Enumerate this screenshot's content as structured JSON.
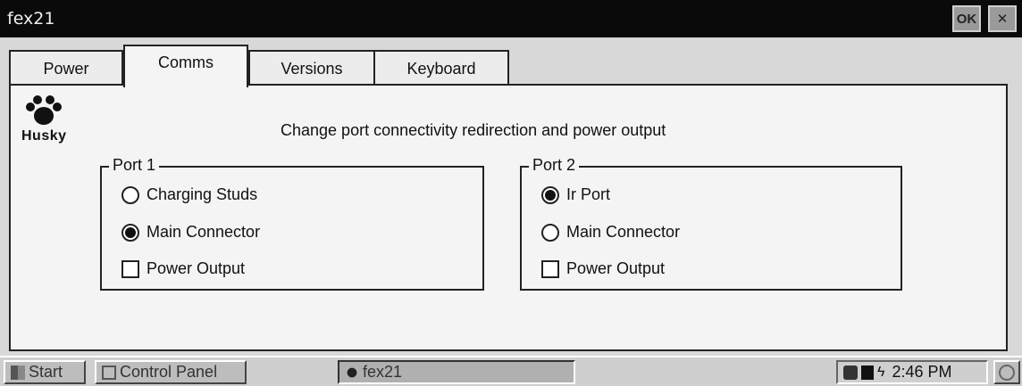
{
  "window": {
    "title": "fex21",
    "ok_label": "OK",
    "close_label": "✕"
  },
  "tabs": [
    {
      "label": "Power"
    },
    {
      "label": "Comms"
    },
    {
      "label": "Versions"
    },
    {
      "label": "Keyboard"
    }
  ],
  "panel": {
    "logo_text": "Husky",
    "header": "Change port connectivity redirection and power output",
    "port1": {
      "label": "Port 1",
      "options": [
        {
          "label": "Charging Studs",
          "checked": false
        },
        {
          "label": "Main Connector",
          "checked": true
        }
      ],
      "power_output": {
        "label": "Power Output",
        "checked": false
      }
    },
    "port2": {
      "label": "Port 2",
      "options": [
        {
          "label": "Ir Port",
          "checked": true
        },
        {
          "label": "Main Connector",
          "checked": false
        }
      ],
      "power_output": {
        "label": "Power Output",
        "checked": false
      }
    }
  },
  "taskbar": {
    "start_label": "Start",
    "items": [
      {
        "label": "Control Panel"
      },
      {
        "label": "fex21"
      }
    ],
    "clock": "2:46 PM"
  }
}
